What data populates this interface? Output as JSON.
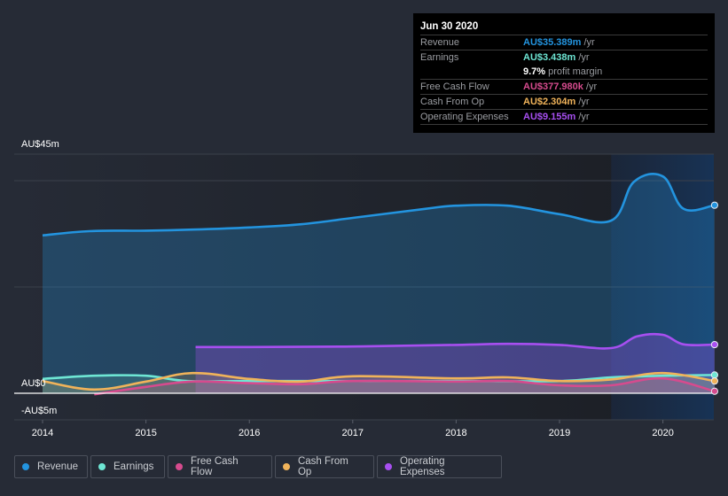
{
  "tooltip": {
    "date": "Jun 30 2020",
    "rows": [
      {
        "label": "Revenue",
        "value": "AU$35.389m",
        "unit": "/yr",
        "color": "#2394df"
      },
      {
        "label": "Earnings",
        "value": "AU$3.438m",
        "unit": "/yr",
        "color": "#6ee6d4"
      },
      {
        "label": "",
        "value": "9.7%",
        "unit": "profit margin",
        "color": "#ffffff"
      },
      {
        "label": "Free Cash Flow",
        "value": "AU$377.980k",
        "unit": "/yr",
        "color": "#d64b8e"
      },
      {
        "label": "Cash From Op",
        "value": "AU$2.304m",
        "unit": "/yr",
        "color": "#f0b35a"
      },
      {
        "label": "Operating Expenses",
        "value": "AU$9.155m",
        "unit": "/yr",
        "color": "#a74ff0"
      }
    ]
  },
  "legend": [
    {
      "label": "Revenue",
      "color": "#2394df"
    },
    {
      "label": "Earnings",
      "color": "#6ee6d4"
    },
    {
      "label": "Free Cash Flow",
      "color": "#d64b8e"
    },
    {
      "label": "Cash From Op",
      "color": "#f0b35a"
    },
    {
      "label": "Operating Expenses",
      "color": "#a74ff0"
    }
  ],
  "chart_data": {
    "type": "area",
    "title": "",
    "xlabel": "",
    "ylabel": "",
    "ylim": [
      -5,
      45
    ],
    "xlim": [
      2013.85,
      2020.55
    ],
    "y_ticks": [
      {
        "value": 45,
        "label": "AU$45m"
      },
      {
        "value": 0,
        "label": "AU$0"
      },
      {
        "value": -5,
        "label": "-AU$5m"
      }
    ],
    "gridlines": [
      45,
      40,
      20,
      -5
    ],
    "x_ticks": [
      {
        "value": 2014,
        "label": "2014"
      },
      {
        "value": 2015,
        "label": "2015"
      },
      {
        "value": 2016,
        "label": "2016"
      },
      {
        "value": 2017,
        "label": "2017"
      },
      {
        "value": 2018,
        "label": "2018"
      },
      {
        "value": 2019,
        "label": "2019"
      },
      {
        "value": 2020,
        "label": "2020"
      }
    ],
    "highlight_region": [
      2019.5,
      2020.5
    ],
    "units": "AU$ millions",
    "series": [
      {
        "name": "Revenue",
        "color": "#2394df",
        "fill": true,
        "x": [
          2014.0,
          2014.45,
          2015.0,
          2015.45,
          2016.0,
          2016.5,
          2017.0,
          2017.7,
          2018.0,
          2018.5,
          2019.0,
          2019.5,
          2019.72,
          2020.0,
          2020.2,
          2020.5
        ],
        "y": [
          29.7,
          30.5,
          30.6,
          30.8,
          31.2,
          31.8,
          33.0,
          34.7,
          35.3,
          35.3,
          33.7,
          32.5,
          39.8,
          40.8,
          34.7,
          35.389
        ]
      },
      {
        "name": "Operating Expenses",
        "color": "#a74ff0",
        "fill": true,
        "x": [
          2015.48,
          2016.0,
          2017.0,
          2018.0,
          2018.5,
          2019.0,
          2019.5,
          2019.75,
          2020.0,
          2020.2,
          2020.5
        ],
        "y": [
          8.7,
          8.7,
          8.8,
          9.1,
          9.3,
          9.1,
          8.5,
          10.7,
          11.0,
          9.2,
          9.155
        ]
      },
      {
        "name": "Earnings",
        "color": "#6ee6d4",
        "fill": true,
        "x": [
          2014.0,
          2014.5,
          2015.0,
          2015.4,
          2016.0,
          2017.0,
          2018.0,
          2019.0,
          2019.5,
          2020.0,
          2020.5
        ],
        "y": [
          2.7,
          3.3,
          3.3,
          2.3,
          2.3,
          2.3,
          2.3,
          2.3,
          3.0,
          3.3,
          3.438
        ]
      },
      {
        "name": "Cash From Op",
        "color": "#f0b35a",
        "fill": true,
        "x": [
          2014.0,
          2014.5,
          2015.0,
          2015.45,
          2016.0,
          2016.5,
          2017.0,
          2018.0,
          2018.5,
          2019.0,
          2019.5,
          2020.0,
          2020.5
        ],
        "y": [
          2.3,
          0.7,
          2.2,
          3.8,
          2.7,
          2.2,
          3.2,
          2.8,
          3.0,
          2.3,
          2.6,
          3.8,
          2.304
        ]
      },
      {
        "name": "Free Cash Flow",
        "color": "#d64b8e",
        "fill": true,
        "x": [
          2014.5,
          2015.0,
          2015.45,
          2016.0,
          2016.5,
          2017.0,
          2018.0,
          2018.5,
          2019.0,
          2019.5,
          2020.0,
          2020.5
        ],
        "y": [
          -0.2,
          1.2,
          2.2,
          1.9,
          1.7,
          2.3,
          2.2,
          2.3,
          1.5,
          1.5,
          2.8,
          0.378
        ]
      }
    ]
  }
}
